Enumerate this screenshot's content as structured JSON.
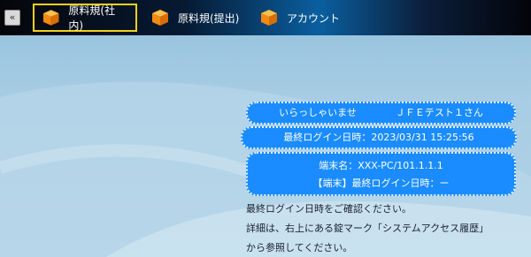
{
  "menu": {
    "collapse_glyph": "«",
    "items": [
      {
        "label": "原料規(社内)",
        "icon": "box-icon",
        "active": true
      },
      {
        "label": "原料規(提出)",
        "icon": "box-icon",
        "active": false
      },
      {
        "label": "アカウント",
        "icon": "box-icon",
        "active": false
      }
    ]
  },
  "welcome": {
    "greeting": "いらっしゃいませ　　　　ＪＦＥテスト１さん",
    "last_login": "最終ログイン日時：2023/03/31 15:25:56",
    "terminal": "端末名：XXX-PC/101.1.1.1",
    "status": "【端末】最終ログイン日時：ー"
  },
  "notice": {
    "line1": "最終ログイン日時をご確認ください。",
    "line2": "詳細は、右上にある錠マーク「システムアクセス履歴」",
    "line3": "から参照してください。"
  },
  "colors": {
    "accent": "#1a8cff",
    "active_border": "#f2d21a",
    "icon_orange": "#f28a14"
  }
}
